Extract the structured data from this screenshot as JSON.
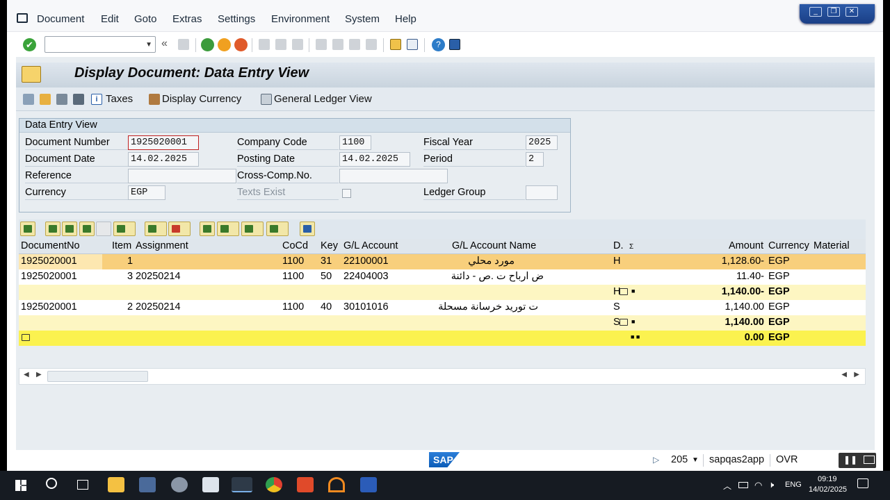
{
  "menu": [
    "Document",
    "Edit",
    "Goto",
    "Extras",
    "Settings",
    "Environment",
    "System",
    "Help"
  ],
  "title": "Display Document: Data Entry View",
  "app_toolbar": {
    "taxes": "Taxes",
    "display_currency": "Display Currency",
    "gl_view": "General Ledger View"
  },
  "group": {
    "header": "Data Entry View",
    "document_number_label": "Document Number",
    "document_number": "1925020001",
    "company_code_label": "Company Code",
    "company_code": "1100",
    "fiscal_year_label": "Fiscal Year",
    "fiscal_year": "2025",
    "document_date_label": "Document Date",
    "document_date": "14.02.2025",
    "posting_date_label": "Posting Date",
    "posting_date": "14.02.2025",
    "period_label": "Period",
    "period": "2",
    "reference_label": "Reference",
    "reference": "",
    "crosscomp_label": "Cross-Comp.No.",
    "crosscomp": "",
    "currency_label": "Currency",
    "currency": "EGP",
    "texts_exist_label": "Texts Exist",
    "ledger_group_label": "Ledger Group",
    "ledger_group": ""
  },
  "grid": {
    "columns": [
      "DocumentNo",
      "Item",
      "Assignment",
      "CoCd",
      "Key",
      "G/L Account",
      "G/L Account Name",
      "D.",
      "Σ",
      "Amount",
      "Currency",
      "Material"
    ],
    "rows": [
      {
        "doc": "1925020001",
        "item": "1",
        "assign": "",
        "cocd": "1100",
        "key": "31",
        "gl": "22100001",
        "name": "مورد محلي",
        "dc": "H",
        "amount": "1,128.60-",
        "cur": "EGP"
      },
      {
        "doc": "1925020001",
        "item": "3",
        "assign": "20250214",
        "cocd": "1100",
        "key": "50",
        "gl": "22404003",
        "name": "ض ارباح ت .ص - دائنة",
        "dc": "",
        "amount": "11.40-",
        "cur": "EGP"
      },
      {
        "subtotal": true,
        "dc": "H",
        "amount": "1,140.00-",
        "cur": "EGP"
      },
      {
        "doc": "1925020001",
        "item": "2",
        "assign": "20250214",
        "cocd": "1100",
        "key": "40",
        "gl": "30101016",
        "name": "ت توريد خرسانة مسحلة",
        "dc": "S",
        "amount": "1,140.00",
        "cur": "EGP"
      },
      {
        "subtotal": true,
        "dc": "S",
        "amount": "1,140.00",
        "cur": "EGP"
      },
      {
        "total": true,
        "amount": "0.00",
        "cur": "EGP"
      }
    ]
  },
  "status": {
    "logo": "SAP",
    "session": "205",
    "server": "sapqas2app",
    "mode": "OVR"
  },
  "taskbar": {
    "lang": "ENG",
    "time": "09:19",
    "date": "14/02/2025"
  },
  "colors": {
    "selected_row": "#f8cf7c",
    "subtotal_row": "#fdf6c2",
    "total_row": "#fbf24f",
    "panel": "#e8edf1"
  }
}
